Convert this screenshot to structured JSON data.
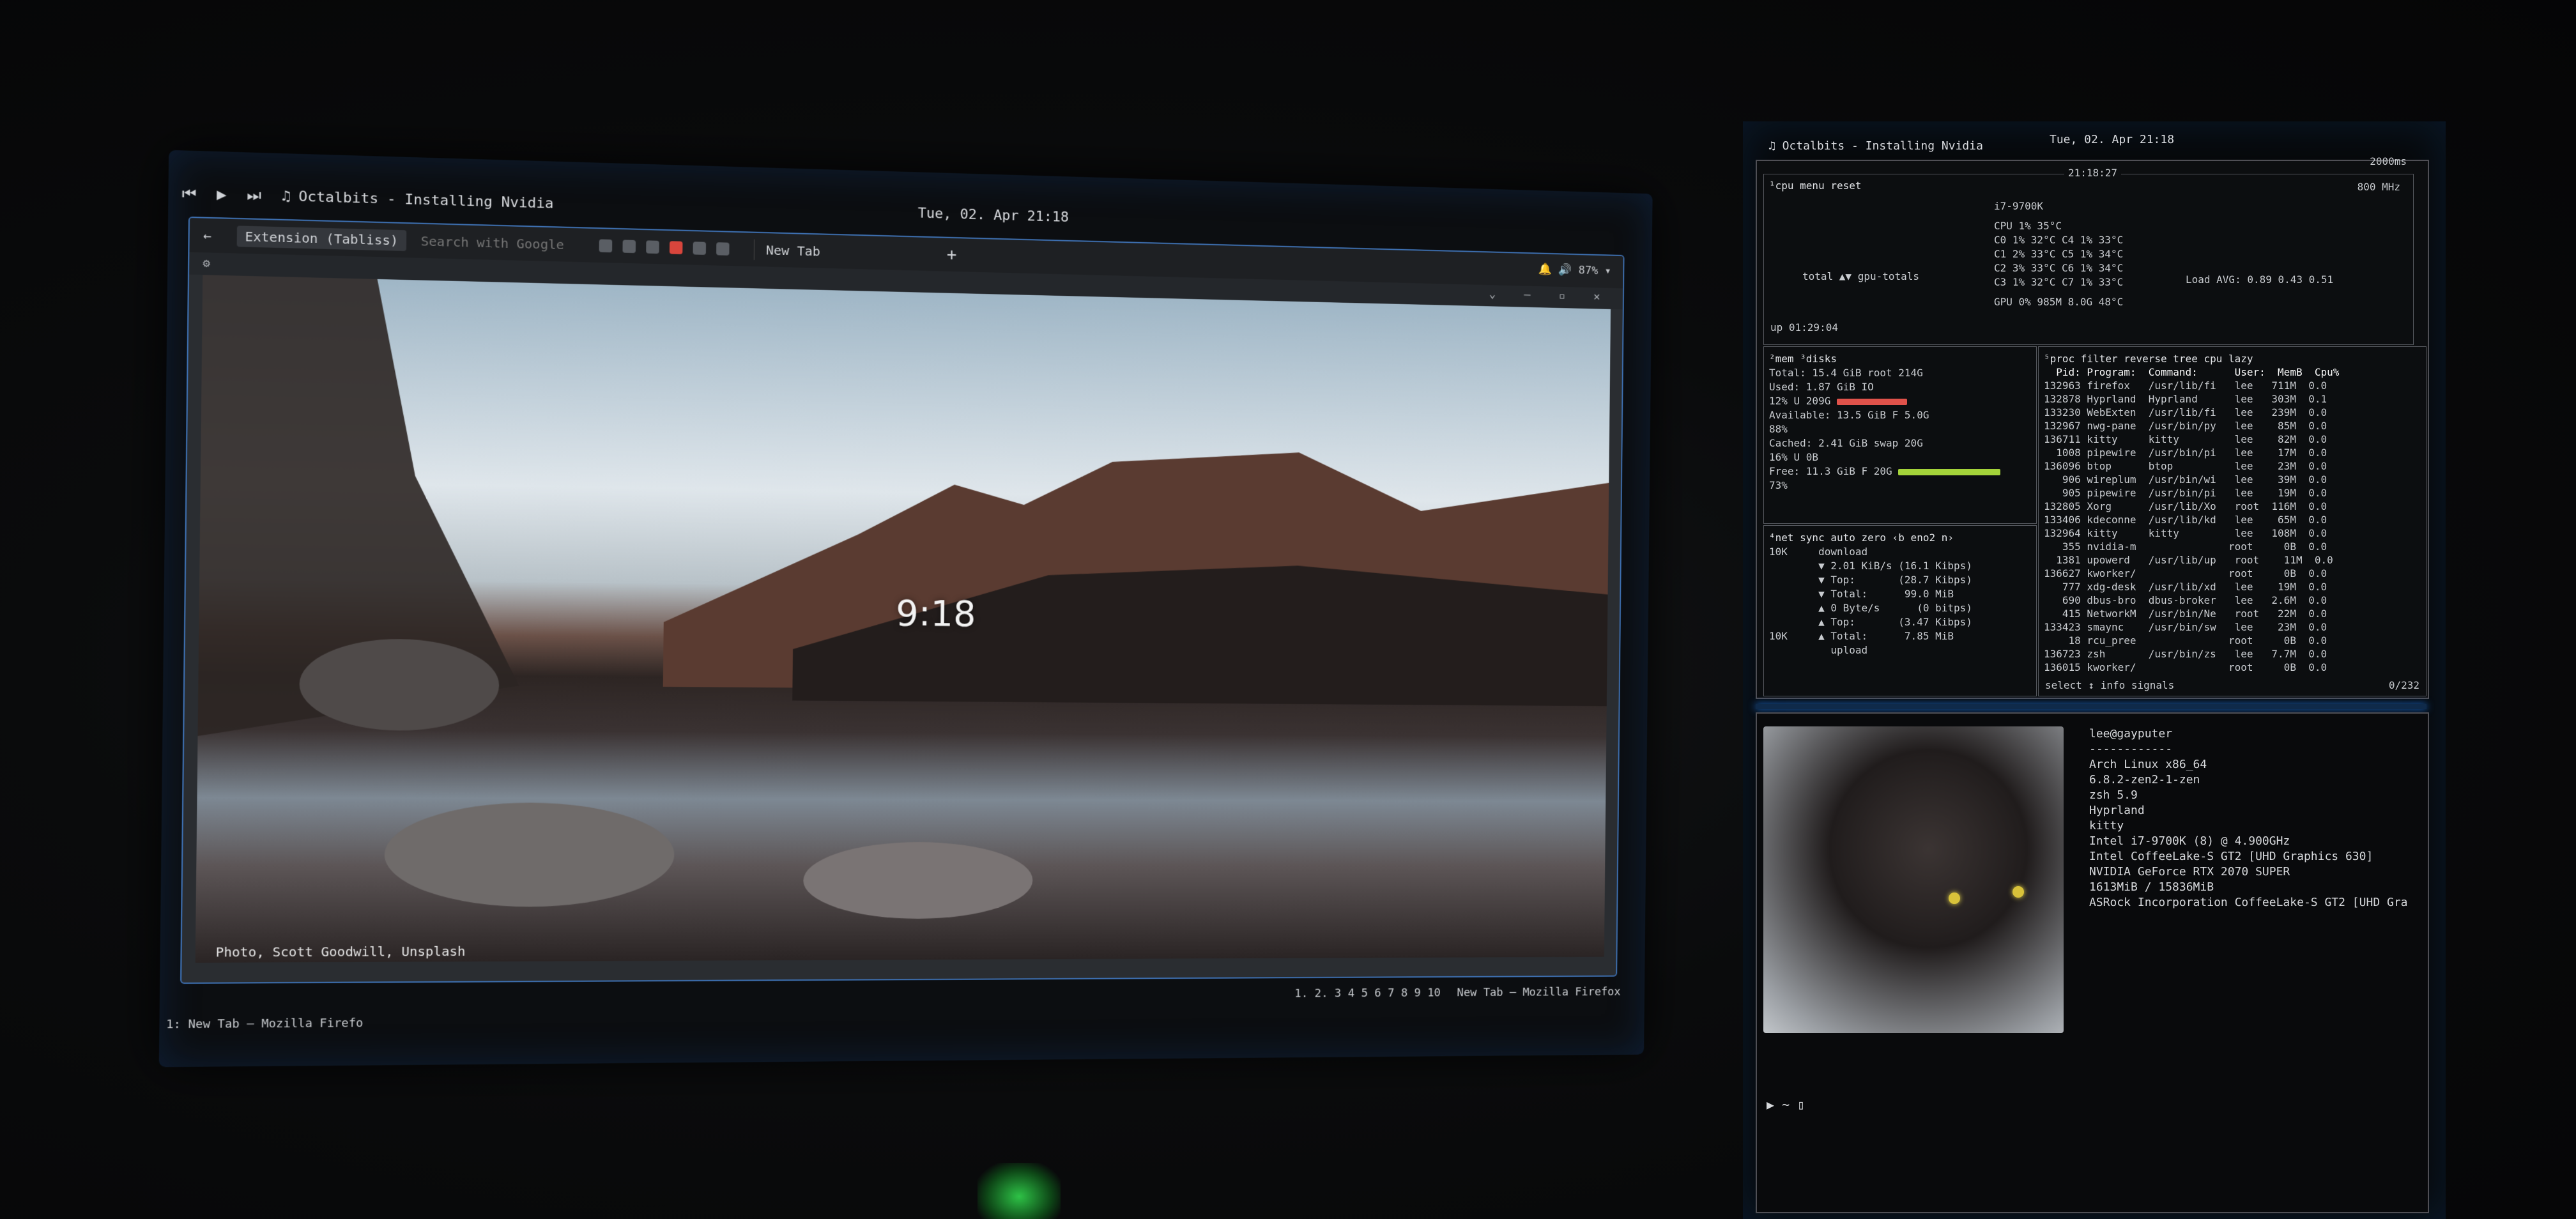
{
  "left_monitor": {
    "top_bar": {
      "prev_icon": "skip-back-icon",
      "play_icon": "play-icon",
      "next_icon": "skip-forward-icon",
      "music_icon": "♫",
      "now_playing": "Octalbits - Installing Nvidia",
      "clock": "Tue, 02. Apr  21:18"
    },
    "browser": {
      "extension_label": "Extension (Tabliss)",
      "search_placeholder": "Search with Google",
      "tab_label": "New Tab",
      "tab_add": "+",
      "tray": "🔔 🔊 87% ▾",
      "window_controls": "⌄ – ▫ ✕"
    },
    "wallpaper": {
      "clock": "9:18",
      "social_icons": "▣ ✉ ◈ ✦",
      "nav_arrows": "← ▪ →",
      "photo_credit": "Photo, Scott Goodwill, Unsplash"
    },
    "workspaces": "1. 2. 3 4 5 6 7 8 9 10",
    "active_window": "New Tab — Mozilla Firefox",
    "taskbar": "1:  New Tab — Mozilla Firefo"
  },
  "right_monitor": {
    "top_bar": {
      "now_playing": "♫ Octalbits - Installing Nvidia",
      "clock": "Tue, 02. Apr  21:18",
      "rate": "2000ms"
    },
    "btop": {
      "cpu_header": "¹cpu menu reset",
      "time": "21:18:27",
      "cpu_model": "i7-9700K",
      "freq": "800 MHz",
      "cpu_rows": [
        "CPU   1%   35°C",
        "C0    1%  32°C C4   1%  33°C",
        "C1    2%  33°C C5   1%  34°C",
        "C2    3%  33°C C6   1%  34°C",
        "C3    1%  32°C C7   1%  33°C"
      ],
      "load_avg": "Load AVG:  0.89  0.43  0.51",
      "gpu_row": "GPU   0%   985M 8.0G   48°C",
      "gpu_totals": "total ▲▼ gpu-totals",
      "uptime": "up 01:29:04",
      "mem": {
        "title": "²mem  ³disks",
        "rows": [
          "Total:   15.4 GiB  root      214G",
          "Used:     1.87 GiB IO",
          "              12%  U         209G",
          "Available: 13.5 GiB F         5.0G",
          "              88%",
          "Cached:   2.41 GiB swap       20G",
          "              16%  U          0B",
          "Free:     11.3 GiB F          20G",
          "              73%"
        ]
      },
      "net": {
        "title": "⁴net  sync auto zero ‹b eno2 n›",
        "rows": [
          "10K     download",
          "        ▼ 2.01 KiB/s (16.1 Kibps)",
          "        ▼ Top:       (28.7 Kibps)",
          "        ▼ Total:      99.0 MiB",
          "",
          "        ▲ 0 Byte/s      (0 bitps)",
          "        ▲ Top:       (3.47 Kibps)",
          "10K     ▲ Total:      7.85 MiB",
          "          upload"
        ]
      },
      "proc": {
        "title": "⁵proc  filter  reverse tree  cpu lazy",
        "header": "  Pid: Program:  Command:      User:  MemB  Cpu%",
        "rows": [
          "132963 firefox   /usr/lib/fi   lee   711M  0.0",
          "132878 Hyprland  Hyprland      lee   303M  0.1",
          "133230 WebExten  /usr/lib/fi   lee   239M  0.0",
          "132967 nwg-pane  /usr/bin/py   lee    85M  0.0",
          "136711 kitty     kitty         lee    82M  0.0",
          "  1008 pipewire  /usr/bin/pi   lee    17M  0.0",
          "136096 btop      btop          lee    23M  0.0",
          "   906 wireplum  /usr/bin/wi   lee    39M  0.0",
          "   905 pipewire  /usr/bin/pi   lee    19M  0.0",
          "132805 Xorg      /usr/lib/Xo   root  116M  0.0",
          "133406 kdeconne  /usr/lib/kd   lee    65M  0.0",
          "132964 kitty     kitty         lee   108M  0.0",
          "   355 nvidia-m               root     0B  0.0",
          "  1381 upowerd   /usr/lib/up   root    11M  0.0",
          "136627 kworker/               root     0B  0.0",
          "   777 xdg-desk  /usr/lib/xd   lee    19M  0.0",
          "   690 dbus-bro  dbus-broker   lee   2.6M  0.0",
          "   415 NetworkM  /usr/bin/Ne   root   22M  0.0",
          "133423 smaync    /usr/bin/sw   lee    23M  0.0",
          "    18 rcu_pree               root     0B  0.0",
          "136723 zsh       /usr/bin/zs   lee   7.7M  0.0",
          "136015 kworker/               root     0B  0.0"
        ],
        "footer": "select ↕  info  signals",
        "count": "0/232"
      }
    },
    "terminal": {
      "sysinfo": [
        "lee@gayputer",
        "------------",
        "Arch Linux x86_64",
        "6.8.2-zen2-1-zen",
        "zsh 5.9",
        "Hyprland",
        "kitty",
        "Intel i7-9700K (8) @ 4.900GHz",
        "Intel CoffeeLake-S GT2 [UHD Graphics 630]",
        "NVIDIA GeForce RTX 2070 SUPER",
        "1613MiB / 15836MiB",
        "ASRock Incorporation CoffeeLake-S GT2 [UHD Gra"
      ],
      "prompt": "▶ ~ ▯"
    }
  }
}
